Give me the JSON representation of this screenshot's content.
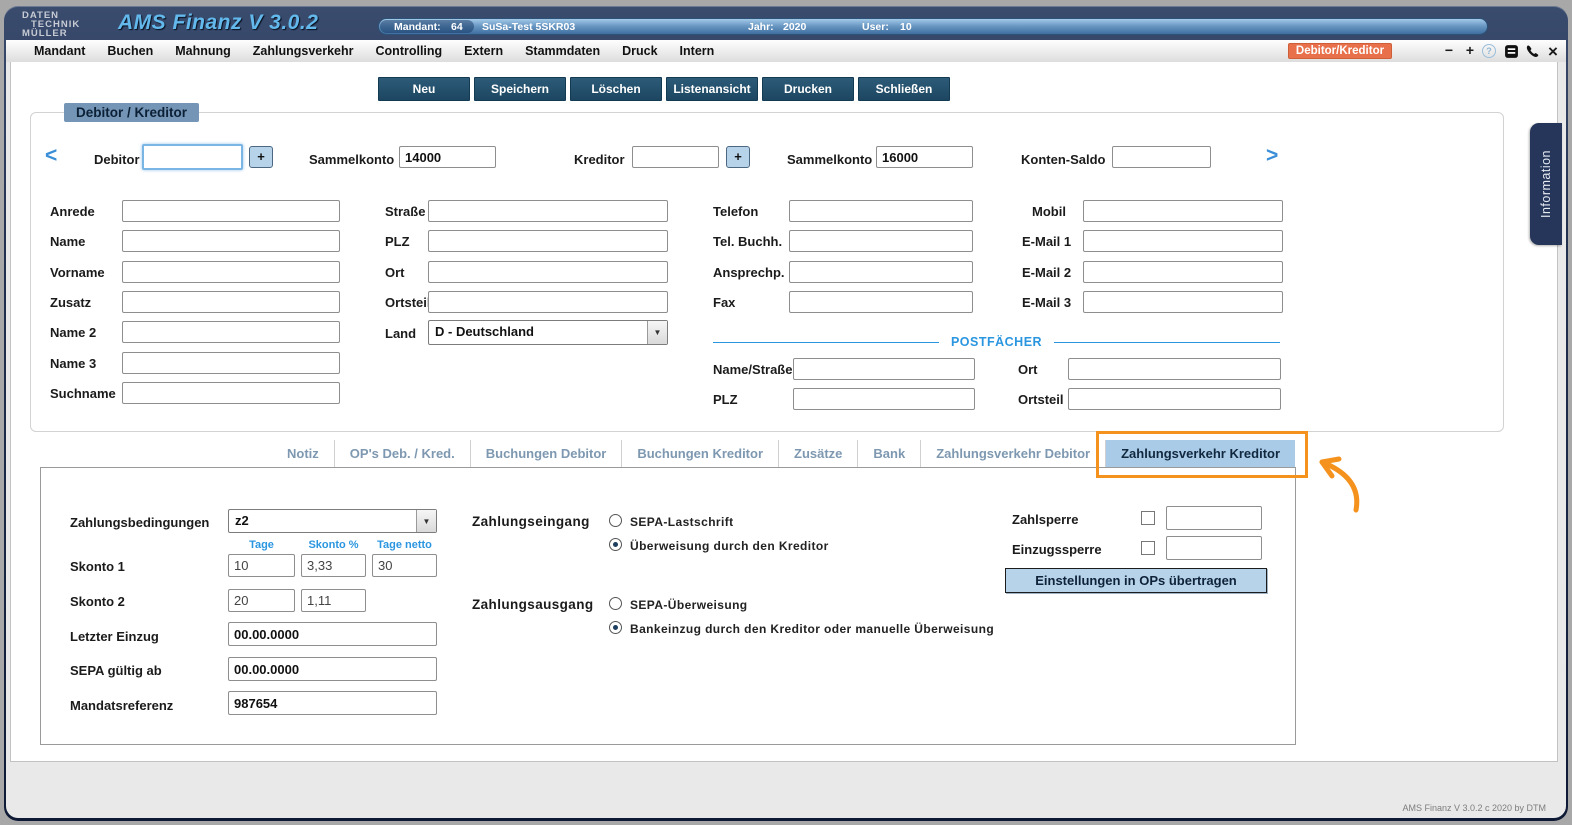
{
  "titlebar": {
    "logo_lines": [
      "DATEN",
      "TECHNIK",
      "MÜLLER"
    ],
    "app_title": "AMS Finanz V 3.0.2",
    "info": {
      "mandant_label": "Mandant:",
      "mandant_value": "64",
      "company": "SuSa-Test 5SKR03",
      "jahr_label": "Jahr:",
      "jahr_value": "2020",
      "user_label": "User:",
      "user_value": "10"
    }
  },
  "menubar": {
    "items": [
      "Mandant",
      "Buchen",
      "Mahnung",
      "Zahlungsverkehr",
      "Controlling",
      "Extern",
      "Stammdaten",
      "Druck",
      "Intern"
    ],
    "active_badge": "Debitor/Kreditor",
    "window_controls": {
      "minimize": "−",
      "maximize": "+",
      "help": "?",
      "close": "×"
    }
  },
  "toolbar": {
    "buttons": [
      "Neu",
      "Speichern",
      "Löschen",
      "Listenansicht",
      "Drucken",
      "Schließen"
    ]
  },
  "form": {
    "group_title": "Debitor / Kreditor",
    "nav": {
      "prev": "<",
      "next": ">"
    },
    "top_row": {
      "debitor_label": "Debitor",
      "debitor_value": "",
      "add_button": "+",
      "sammelkonto_debitor_label": "Sammelkonto",
      "sammelkonto_debitor_value": "14000",
      "kreditor_label": "Kreditor",
      "kreditor_value": "",
      "sammelkonto_kreditor_label": "Sammelkonto",
      "sammelkonto_kreditor_value": "16000",
      "konten_saldo_label": "Konten-Saldo",
      "konten_saldo_value": ""
    },
    "identity": {
      "labels": [
        "Anrede",
        "Name",
        "Vorname",
        "Zusatz",
        "Name 2",
        "Name 3",
        "Suchname"
      ]
    },
    "address": {
      "labels": [
        "Straße",
        "PLZ",
        "Ort",
        "Ortsteil"
      ],
      "land_label": "Land",
      "land_value": "D -  Deutschland"
    },
    "contact": {
      "labels": [
        "Telefon",
        "Tel. Buchh.",
        "Ansprechp.",
        "Fax"
      ]
    },
    "mobile_email": {
      "labels": [
        "Mobil",
        "E-Mail 1",
        "E-Mail 2",
        "E-Mail 3"
      ]
    },
    "postfaecher": {
      "title": "POSTFÄCHER",
      "name_strasse_label": "Name/Straße",
      "plz_label": "PLZ",
      "ort_label": "Ort",
      "ortsteil_label": "Ortsteil"
    }
  },
  "tabs": {
    "items": [
      "Notiz",
      "OP's Deb. / Kred.",
      "Buchungen Debitor",
      "Buchungen Kreditor",
      "Zusätze",
      "Bank",
      "Zahlungsverkehr Debitor",
      "Zahlungsverkehr Kreditor"
    ],
    "active": "Zahlungsverkehr Kreditor"
  },
  "payment": {
    "zahlungsbedingungen_label": "Zahlungsbedingungen",
    "zahlungsbedingungen_value": "z2",
    "skonto_headers": [
      "Tage",
      "Skonto %",
      "Tage netto"
    ],
    "skonto1_label": "Skonto 1",
    "skonto1_tage": "10",
    "skonto1_prozent": "3,33",
    "skonto1_tage_netto": "30",
    "skonto2_label": "Skonto 2",
    "skonto2_tage": "20",
    "skonto2_prozent": "1,11",
    "letzter_einzug_label": "Letzter Einzug",
    "letzter_einzug_value": "00.00.0000",
    "sepa_gueltig_label": "SEPA gültig ab",
    "sepa_gueltig_value": "00.00.0000",
    "mandatsreferenz_label": "Mandatsreferenz",
    "mandatsreferenz_value": "987654",
    "zahlungseingang_label": "Zahlungseingang",
    "zahlungseingang_options": [
      {
        "label": "SEPA-Lastschrift",
        "selected": false
      },
      {
        "label": "Überweisung durch den Kreditor",
        "selected": true
      }
    ],
    "zahlungsausgang_label": "Zahlungsausgang",
    "zahlungsausgang_options": [
      {
        "label": "SEPA-Überweisung",
        "selected": false
      },
      {
        "label": "Bankeinzug durch den Kreditor oder manuelle Überweisung",
        "selected": true
      }
    ],
    "zahlsperre_label": "Zahlsperre",
    "zahlsperre_checked": false,
    "zahlsperre_value": "",
    "einzugssperre_label": "Einzugssperre",
    "einzugssperre_checked": false,
    "einzugssperre_value": "",
    "transfer_button": "Einstellungen in OPs übertragen"
  },
  "side_tab": "Information",
  "footer": "AMS Finanz V 3.0.2 c  2020 by DTM",
  "colors": {
    "accent_orange": "#e8714b",
    "annotation_orange": "#f5921e",
    "active_tab_bg": "#a9cbe8",
    "link_blue": "#2b96e0",
    "toolbar_button_bg": "#1d4662",
    "group_badge_bg": "#7495b6",
    "titlebar_navy": "#22304f"
  }
}
